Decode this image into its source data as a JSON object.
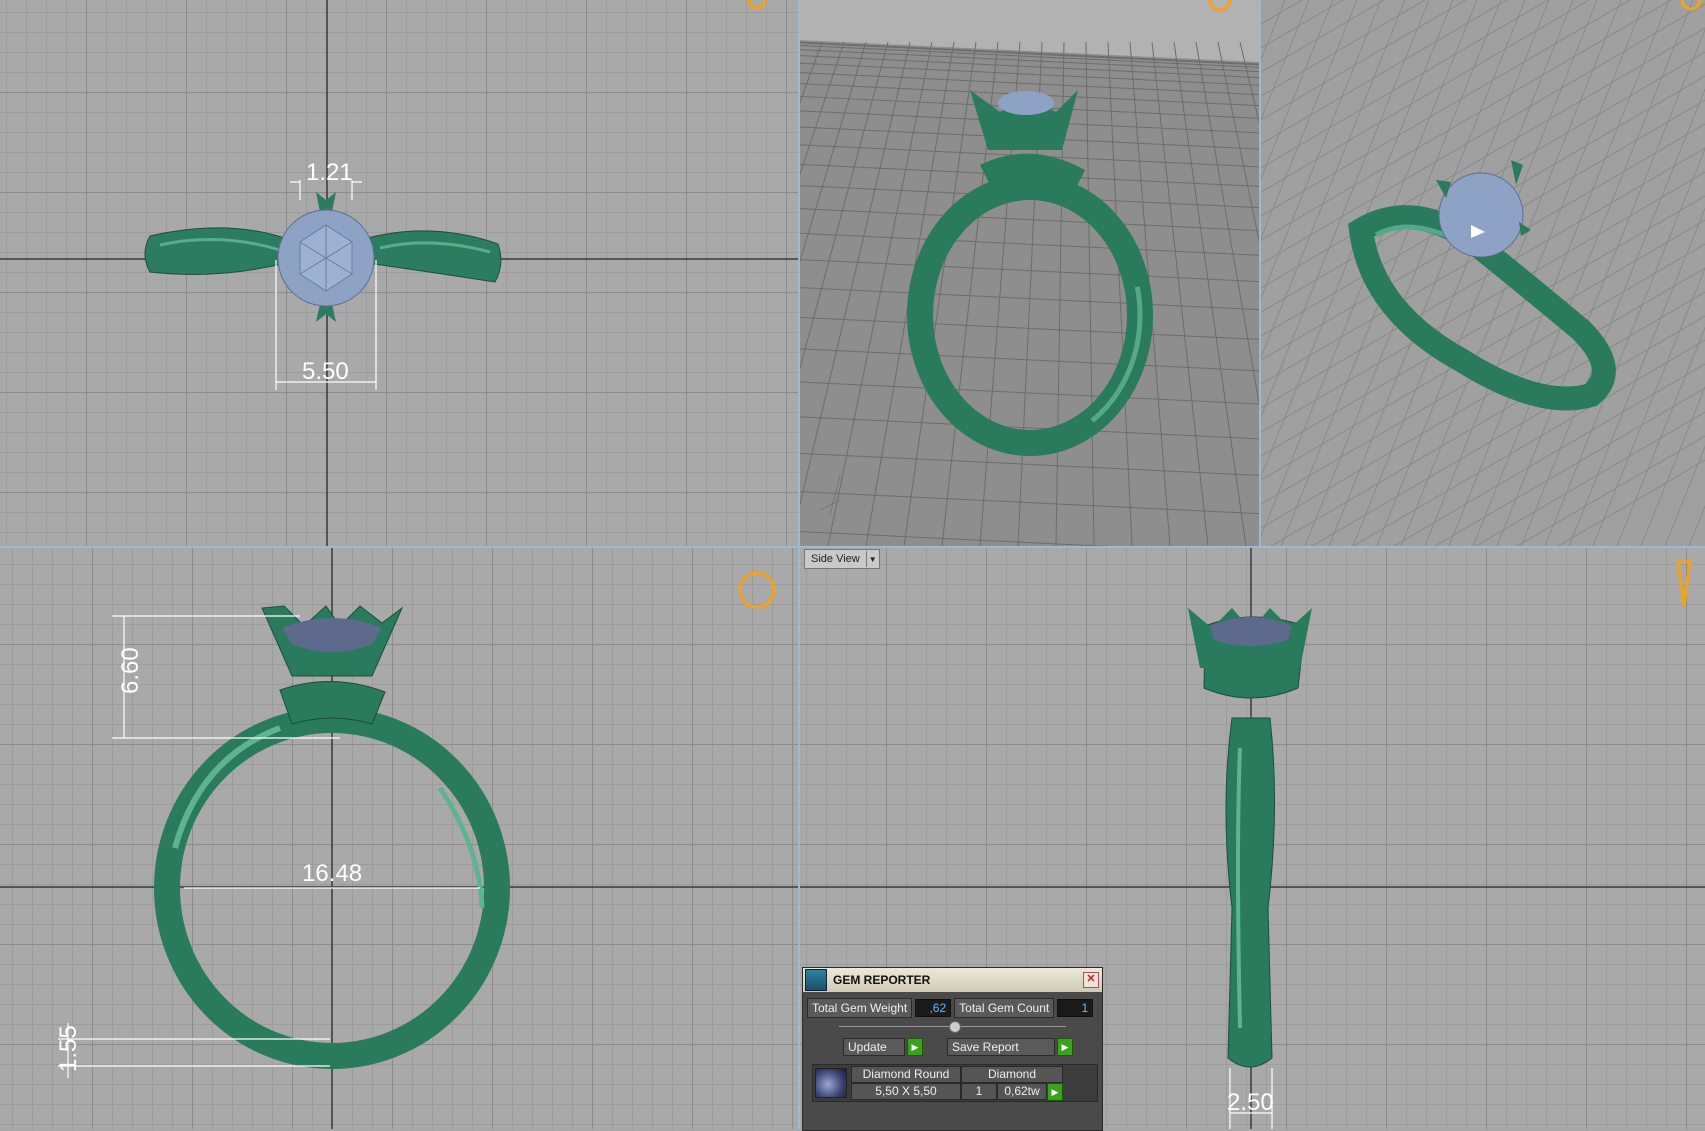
{
  "viewports": {
    "top": {
      "dims": {
        "prong": "1.21",
        "stone": "5.50"
      }
    },
    "front": {
      "dims": {
        "head_height": "6.60",
        "inner_diameter": "16.48",
        "shank_thickness": "1.55"
      }
    },
    "side": {
      "dims": {
        "shank_width": "2.50"
      },
      "view_label": "Side View"
    }
  },
  "gem_reporter": {
    "title": "GEM REPORTER",
    "total_weight_label": "Total Gem Weight",
    "total_weight_value": ",62",
    "total_count_label": "Total Gem Count",
    "total_count_value": "1",
    "update_label": "Update",
    "save_report_label": "Save Report",
    "gem": {
      "cut": "Diamond Round",
      "material": "Diamond",
      "size": "5,50 X 5,50",
      "count": "1",
      "weight": "0,62tw"
    }
  },
  "colors": {
    "metal": "#2a7a5e",
    "gem": "#8fa3c9",
    "grid_bg": "#a9a9a9",
    "accent": "#f3a21c"
  }
}
